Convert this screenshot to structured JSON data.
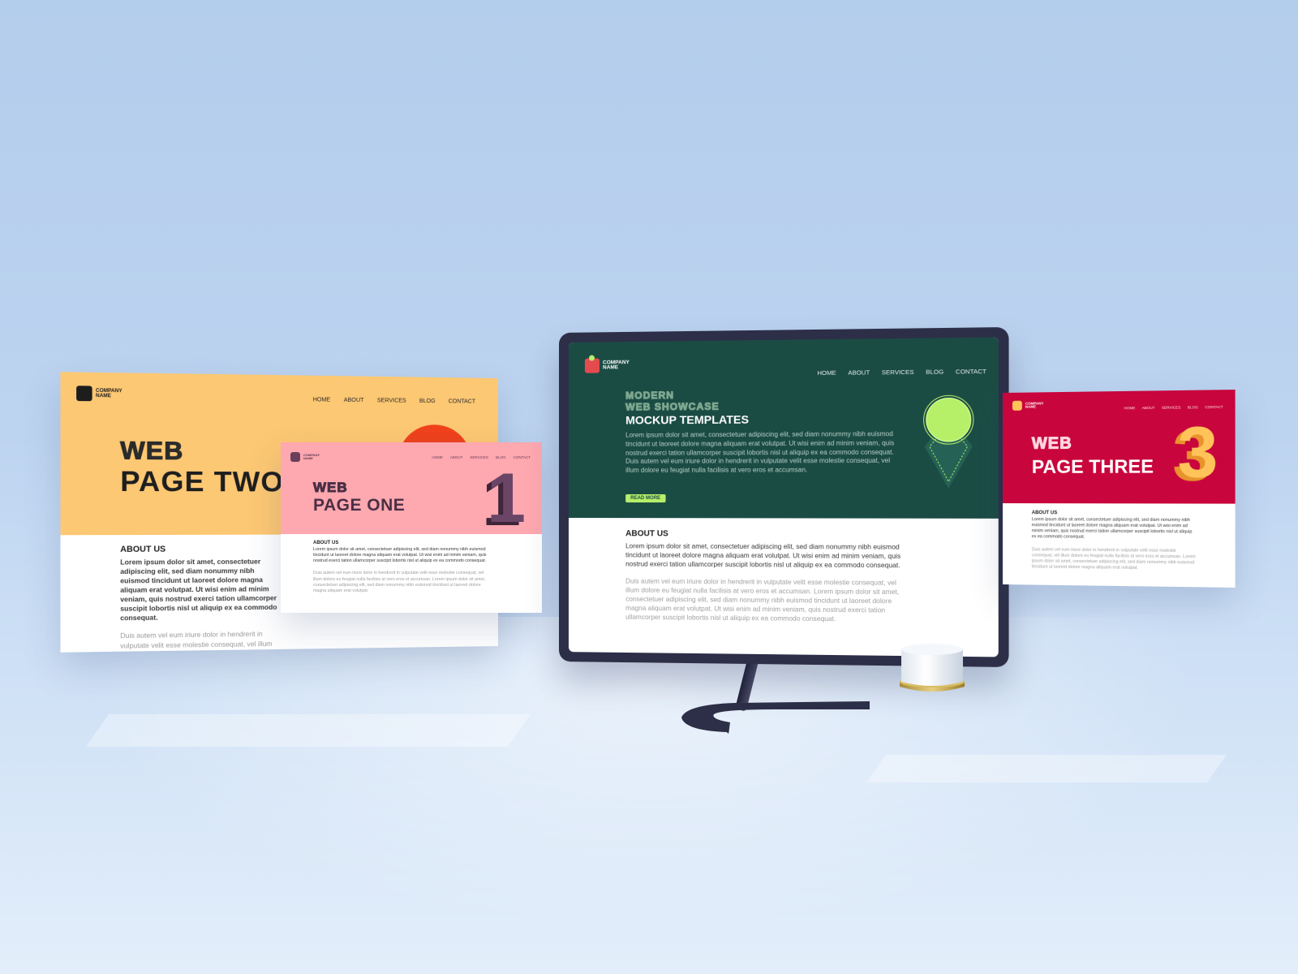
{
  "colors": {
    "background": "#b3cdec",
    "page_two_hero": "#fdc873",
    "page_two_accent": "#f0421c",
    "page_one_hero": "#fea8b0",
    "page_one_text": "#4b2f45",
    "monitor_hero": "#1b4c44",
    "monitor_accent": "#b6f069",
    "page_three_hero": "#c8053c",
    "page_three_number": "#ffc35a",
    "monitor_bezel": "#2d2f48"
  },
  "page_two": {
    "logo_line1": "COMPANY",
    "logo_line2": "NAME",
    "nav": [
      "HOME",
      "ABOUT",
      "SERVICES",
      "BLOG",
      "CONTACT"
    ],
    "title_outline": "WEB",
    "title": "PAGE TWO",
    "about_heading": "ABOUT US",
    "paragraph1": "Lorem ipsum dolor sit amet, consectetuer adipiscing elit, sed diam nonummy nibh euismod tincidunt ut laoreet dolore magna aliquam erat volutpat. Ut wisi enim ad minim veniam, quis nostrud exerci tation ullamcorper suscipit lobortis nisl ut aliquip ex ea commodo consequat.",
    "paragraph2": "Duis autem vel eum iriure dolor in hendrerit in vulputate velit esse molestie consequat, vel illum dolore eu feugiat nulla facilisis at vero eros et accumsan. Lorem ipsum dolor sit amet, consectetuer adipiscing elit, sed diam nonummy nibh euismod tincidunt ut laoreet dolore magna aliquam erat volutpat. Ut wisi enim ad minim veniam, quis nostrud exerci tation ullamcorper suscipit lobortis nisl ut aliquip ex ea commodo consequat."
  },
  "page_one": {
    "logo_line1": "COMPANY",
    "logo_line2": "NAME",
    "nav": [
      "HOME",
      "ABOUT",
      "SERVICES",
      "BLOG",
      "CONTACT"
    ],
    "title_outline": "WEB",
    "title": "PAGE ONE",
    "number": "1",
    "about_heading": "ABOUT US",
    "paragraph1": "Lorem ipsum dolor sit amet, consectetuer adipiscing elit, sed diam nonummy nibh euismod tincidunt ut laoreet dolore magna aliquam erat volutpat. Ut wisi enim ad minim veniam, quis nostrud exerci tation ullamcorper suscipit lobortis nisl ut aliquip ex ea commodo consequat.",
    "paragraph2": "Duis autem vel eum iriure dolor in hendrerit in vulputate velit esse molestie consequat, vel illum dolore eu feugiat nulla facilisis at vero eros et accumsan. Lorem ipsum dolor sit amet, consectetuer adipiscing elit, sed diam nonummy nibh euismod tincidunt ut laoreet dolore magna aliquam erat volutpat."
  },
  "monitor": {
    "logo_line1": "COMPANY",
    "logo_line2": "NAME",
    "nav": [
      "HOME",
      "ABOUT",
      "SERVICES",
      "BLOG",
      "CONTACT"
    ],
    "title_outline_line1": "MODERN",
    "title_outline_line2": "WEB SHOWCASE",
    "title": "MOCKUP TEMPLATES",
    "lead": "Lorem ipsum dolor sit amet, consectetuer adipiscing elit, sed diam nonummy nibh euismod tincidunt ut laoreet dolore magna aliquam erat volutpat. Ut wisi enim ad minim veniam, quis nostrud exerci tation ullamcorper suscipit lobortis nisl ut aliquip ex ea commodo consequat. Duis autem vel eum iriure dolor in hendrerit in vulputate velit esse molestie consequat, vel illum dolore eu feugiat nulla facilisis at vero eros et accumsan.",
    "read_more": "READ MORE",
    "about_heading": "ABOUT US",
    "paragraph1": "Lorem ipsum dolor sit amet, consectetuer adipiscing elit, sed diam nonummy nibh euismod tincidunt ut laoreet dolore magna aliquam erat volutpat. Ut wisi enim ad minim veniam, quis nostrud exerci tation ullamcorper suscipit lobortis nisl ut aliquip ex ea commodo consequat.",
    "paragraph2": "Duis autem vel eum iriure dolor in hendrerit in vulputate velit esse molestie consequat, vel illum dolore eu feugiat nulla facilisis at vero eros et accumsan. Lorem ipsum dolor sit amet, consectetuer adipiscing elit, sed diam nonummy nibh euismod tincidunt ut laoreet dolore magna aliquam erat volutpat. Ut wisi enim ad minim veniam, quis nostrud exerci tation ullamcorper suscipit lobortis nisl ut aliquip ex ea commodo consequat."
  },
  "page_three": {
    "logo_line1": "COMPANY",
    "logo_line2": "NAME",
    "nav": [
      "HOME",
      "ABOUT",
      "SERVICES",
      "BLOG",
      "CONTACT"
    ],
    "title_outline": "WEB",
    "title": "PAGE THREE",
    "number": "3",
    "about_heading": "ABOUT US",
    "paragraph1": "Lorem ipsum dolor sit amet, consectetuer adipiscing elit, sed diam nonummy nibh euismod tincidunt ut laoreet dolore magna aliquam erat volutpat. Ut wisi enim ad minim veniam, quis nostrud exerci tation ullamcorper suscipit lobortis nisl ut aliquip ex ea commodo consequat.",
    "paragraph2": "Duis autem vel eum iriure dolor in hendrerit in vulputate velit esse molestie consequat, vel illum dolore eu feugiat nulla facilisis at vero eros et accumsan. Lorem ipsum dolor sit amet, consectetuer adipiscing elit, sed diam nonummy nibh euismod tincidunt ut laoreet dolore magna aliquam erat volutpat."
  }
}
